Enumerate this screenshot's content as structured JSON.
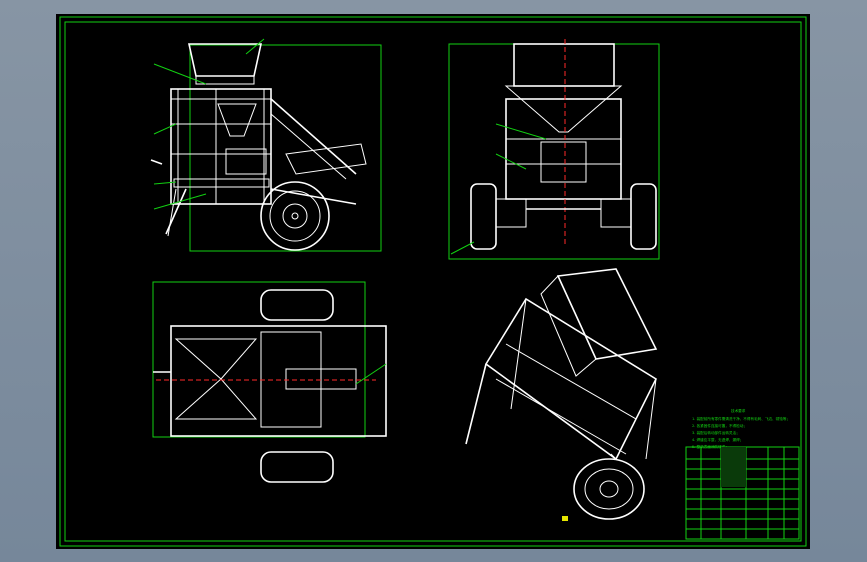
{
  "drawing": {
    "title": "",
    "colors": {
      "background": "#000000",
      "frame": "#12d012",
      "lines": "#ffffff",
      "centerline": "#ff2a2a",
      "notes_text": "#e6e600"
    }
  },
  "views": [
    {
      "name": "front-view"
    },
    {
      "name": "side-view"
    },
    {
      "name": "top-view"
    },
    {
      "name": "isometric-view"
    }
  ],
  "notes": {
    "heading": "技术要求",
    "lines": [
      "1. 装配前所有零件需清洗干净，不得有毛刺、飞边、锈蚀等；",
      "2. 各紧固件连接可靠，不得松动；",
      "3. 装配后转动部件运转灵活；",
      "4. 焊缝应平整，无虚焊、漏焊；",
      "5. 整机表面涂防锈漆；"
    ]
  }
}
